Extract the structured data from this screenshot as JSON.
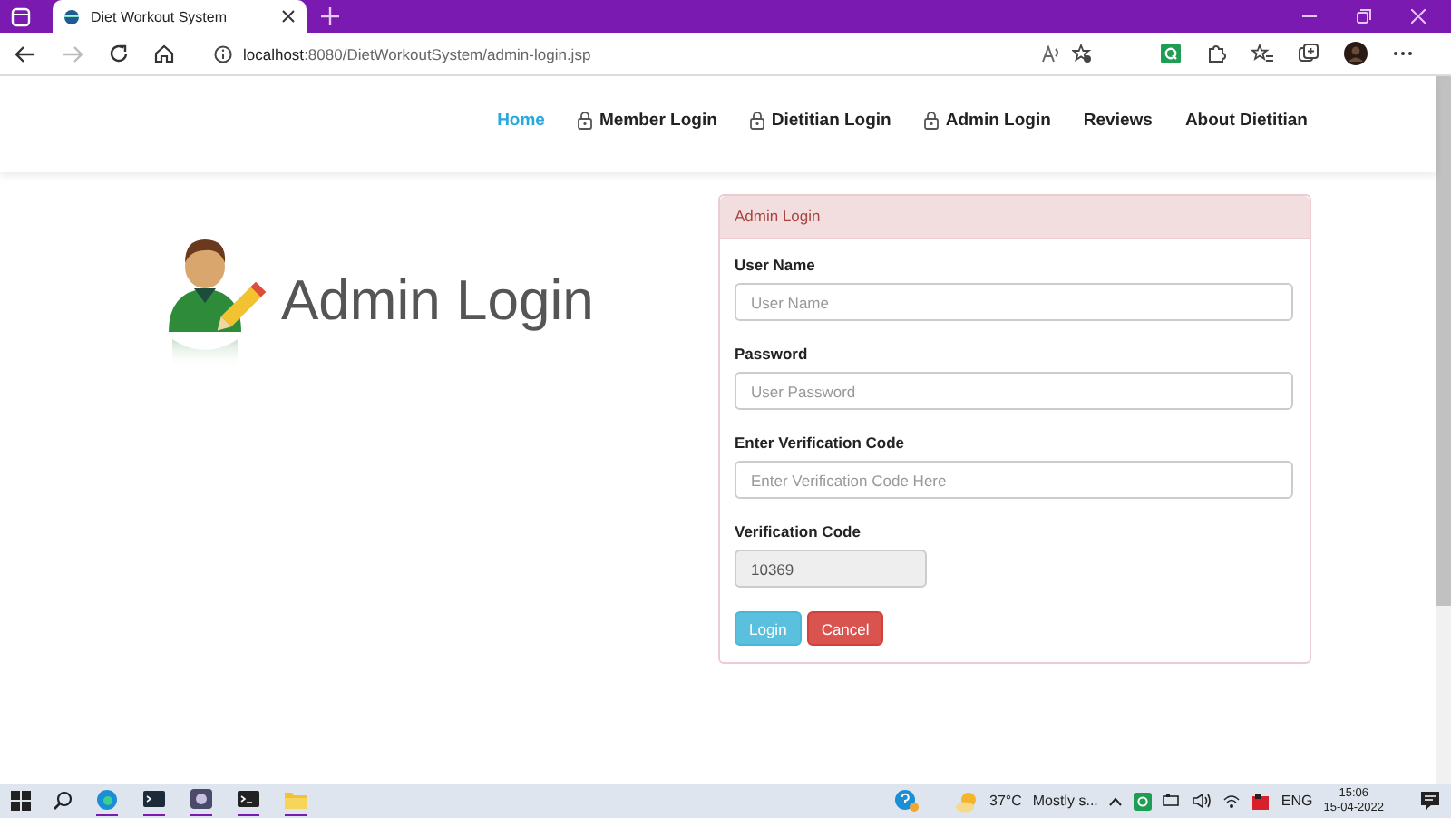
{
  "browser": {
    "tab": {
      "title": "Diet Workout System"
    },
    "address": {
      "host": "localhost",
      "path": ":8080/DietWorkoutSystem/admin-login.jsp"
    }
  },
  "nav": {
    "items": [
      {
        "label": "Home",
        "selected": true,
        "locked": false
      },
      {
        "label": "Member Login",
        "selected": false,
        "locked": true
      },
      {
        "label": "Dietitian Login",
        "selected": false,
        "locked": true
      },
      {
        "label": "Admin Login",
        "selected": false,
        "locked": true
      },
      {
        "label": "Reviews",
        "selected": false,
        "locked": false
      },
      {
        "label": "About Dietitian",
        "selected": false,
        "locked": false
      }
    ]
  },
  "hero": {
    "title": "Admin Login"
  },
  "card": {
    "title": "Admin Login",
    "fields": [
      {
        "kind": "input",
        "label": "User Name",
        "placeholder": "User Name"
      },
      {
        "kind": "input",
        "label": "Password",
        "placeholder": "User Password"
      },
      {
        "kind": "input",
        "label": "Enter Verification Code",
        "placeholder": "Enter Verification Code Here"
      },
      {
        "kind": "readonly",
        "label": "Verification Code",
        "value": "10369"
      }
    ],
    "buttons": [
      {
        "kind": "info",
        "label": "Login"
      },
      {
        "kind": "danger",
        "label": "Cancel"
      }
    ]
  },
  "taskbar": {
    "weather": {
      "temperature": "37°C",
      "condition": "Mostly s..."
    },
    "language": "ENG",
    "time": "15:06",
    "date": "15-04-2022"
  }
}
